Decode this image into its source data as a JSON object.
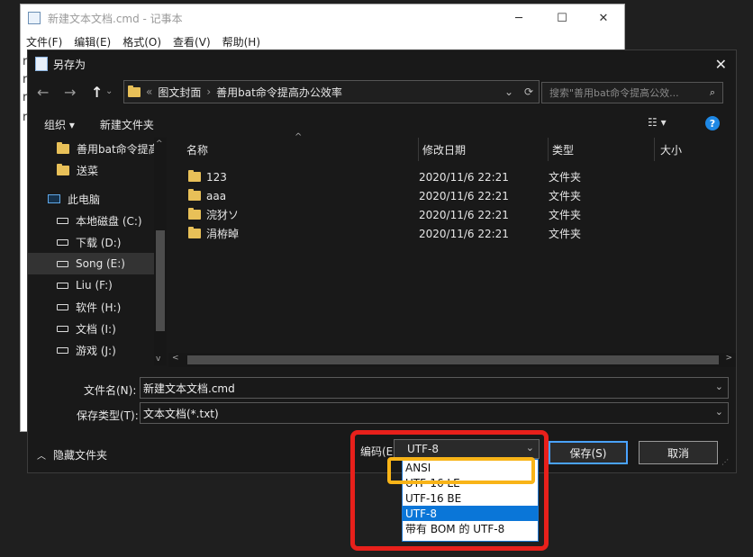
{
  "notepad": {
    "title": "新建文本文档.cmd - 记事本",
    "menu": [
      "文件(F)",
      "编辑(E)",
      "格式(O)",
      "查看(V)",
      "帮助(H)"
    ],
    "controls": {
      "minimize": "─",
      "maximize": "☐",
      "close": "✕"
    },
    "lines": [
      "r",
      "r",
      "r",
      "r"
    ]
  },
  "dialog": {
    "title": "另存为",
    "close": "✕",
    "nav": {
      "back": "←",
      "forward": "→",
      "up": "↑"
    },
    "address": {
      "prefix": "«",
      "crumbs": [
        "图文封面",
        "善用bat命令提高办公效率"
      ],
      "sep": "›",
      "dropdown": "⌄",
      "refresh": "⟳"
    },
    "search": {
      "placeholder": "搜索\"善用bat命令提高公效...",
      "icon": "⌕"
    },
    "toolbar": {
      "organize": "组织 ▾",
      "new_folder": "新建文件夹",
      "view": "☷ ▾",
      "help": "?"
    },
    "sidebar": [
      {
        "label": "善用bat命令提高",
        "icon": "folder"
      },
      {
        "label": "送菜",
        "icon": "folder"
      },
      {
        "label": "此电脑",
        "icon": "pc"
      },
      {
        "label": "本地磁盘 (C:)",
        "icon": "drive"
      },
      {
        "label": "下载 (D:)",
        "icon": "drive"
      },
      {
        "label": "Song (E:)",
        "icon": "drive"
      },
      {
        "label": "Liu (F:)",
        "icon": "drive"
      },
      {
        "label": "软件 (H:)",
        "icon": "drive"
      },
      {
        "label": "文档 (I:)",
        "icon": "drive"
      },
      {
        "label": "游戏 (J:)",
        "icon": "drive"
      }
    ],
    "columns": [
      "名称",
      "修改日期",
      "类型",
      "大小"
    ],
    "files": [
      {
        "name": "123",
        "date": "2020/11/6 22:21",
        "type": "文件夹"
      },
      {
        "name": "aaa",
        "date": "2020/11/6 22:21",
        "type": "文件夹"
      },
      {
        "name": "浣犲ソ",
        "date": "2020/11/6 22:21",
        "type": "文件夹"
      },
      {
        "name": "涓栫晫",
        "date": "2020/11/6 22:21",
        "type": "文件夹"
      }
    ],
    "filename_label": "文件名(N):",
    "filename_value": "新建文本文档.cmd",
    "filetype_label": "保存类型(T):",
    "filetype_value": "文本文档(*.txt)",
    "hide_folders": "隐藏文件夹",
    "encoding_label": "编码(E):",
    "encoding_value": "UTF-8",
    "save_button": "保存(S)",
    "cancel_button": "取消",
    "encoding_options": [
      "ANSI",
      "UTF-16 LE",
      "UTF-16 BE",
      "UTF-8",
      "带有 BOM 的 UTF-8"
    ],
    "selected_option": "UTF-8"
  },
  "colors": {
    "highlight_red": "#e8201b",
    "highlight_yellow": "#f8b418",
    "accent": "#0a76d8"
  }
}
